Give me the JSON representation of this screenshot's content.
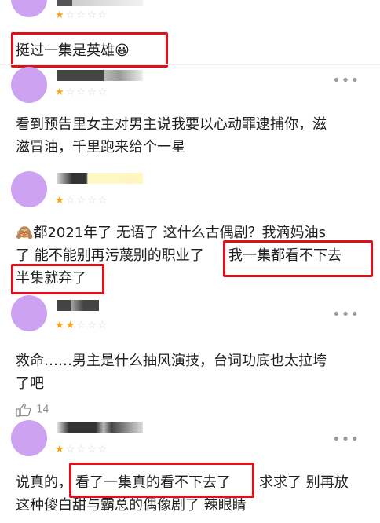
{
  "comments": [
    {
      "stars": [
        "★",
        "☆",
        "☆",
        "☆",
        "☆"
      ],
      "text": [
        "挺过一集是英雄😀"
      ]
    },
    {
      "stars": [
        "★",
        "☆",
        "☆",
        "☆",
        "☆"
      ],
      "more": "•••",
      "text": [
        "看到预告里女主对男主说我要以心动罪逮捕你，滋",
        "滋冒油，千里跑来给个一星"
      ]
    },
    {
      "stars": [
        "★",
        "☆",
        "☆",
        "☆",
        "☆"
      ],
      "text_l1a": "🙈都2021年了 无语了 这什么古偶剧？我滴妈油s",
      "text_l2a": "了 能不能别再污蔑别的职业了",
      "text_l2b": "我一集都看不下去",
      "text_l3": "半集就弃了"
    },
    {
      "stars": [
        "★",
        "★",
        "☆",
        "☆",
        "☆"
      ],
      "more": "•••",
      "text": [
        "救命……男主是什么抽风演技，台词功底也太拉垮",
        "了吧"
      ],
      "likes": "14"
    },
    {
      "stars": [
        "★",
        "☆",
        "☆",
        "☆",
        "☆"
      ],
      "more": "•••",
      "text_l1a": "说真的，",
      "text_l1b": "看了一集真的看不下去了",
      "text_l1c": "求求了 别再放",
      "text_l2": "这种傻白甜与霸总的偶像剧了 辣眼睛"
    }
  ],
  "colors": {
    "highlight": "#e0101b",
    "star_on": "#f5a516",
    "avatar": "#cda2f1"
  }
}
